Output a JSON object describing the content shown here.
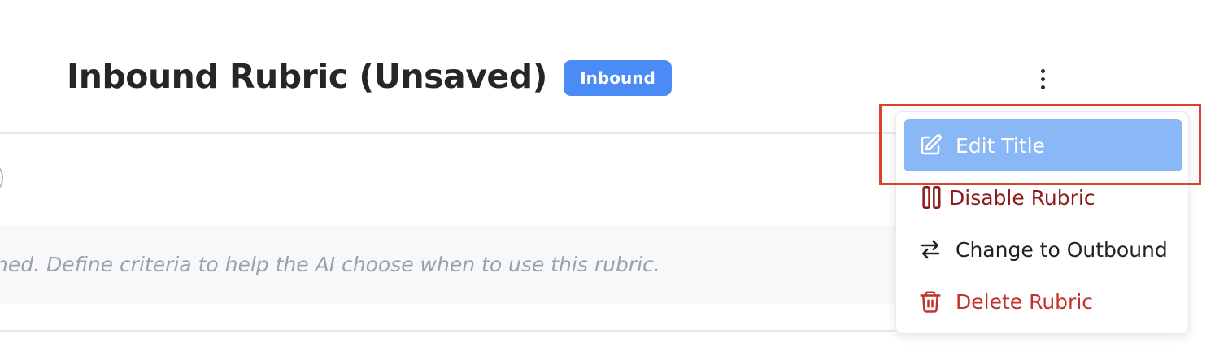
{
  "header": {
    "title": "Inbound Rubric (Unsaved)",
    "badge": "Inbound",
    "more_menu_icon": "vertical-ellipsis-icon"
  },
  "rubric": {
    "criteria_text": "ned. Define criteria to help the AI choose when to use this rubric."
  },
  "menu": {
    "items": [
      {
        "label": "Edit Title",
        "icon": "edit-icon",
        "color": "#ffffff",
        "highlighted": true
      },
      {
        "label": "Disable Rubric",
        "icon": "pause-icon",
        "color": "#8b1c1c"
      },
      {
        "label": "Change to Outbound",
        "icon": "swap-arrows-icon",
        "color": "#222222"
      },
      {
        "label": "Delete Rubric",
        "icon": "trash-icon",
        "color": "#c0322b"
      }
    ]
  },
  "colors": {
    "badge": "#4b8bf5",
    "menu_active_bg": "#8ab7f5",
    "highlight_border": "#d9432b"
  }
}
